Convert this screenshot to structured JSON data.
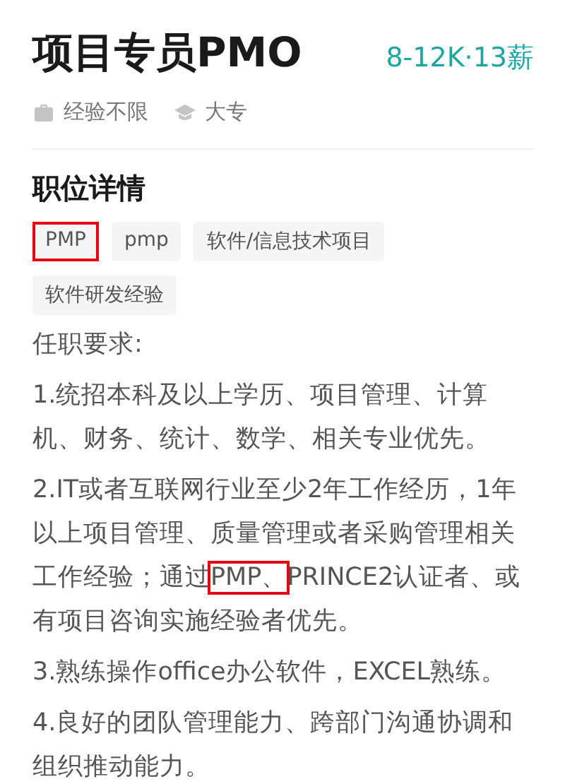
{
  "job": {
    "title": "项目专员PMO",
    "salary": "8-12K·13薪",
    "meta": [
      {
        "kind": "experience",
        "text": "经验不限"
      },
      {
        "kind": "education",
        "text": "大专"
      }
    ]
  },
  "details": {
    "heading": "职位详情",
    "tags": [
      {
        "label": "PMP",
        "highlighted": true
      },
      {
        "label": "pmp",
        "highlighted": false
      },
      {
        "label": "软件/信息技术项目",
        "highlighted": false
      },
      {
        "label": "软件研发经验",
        "highlighted": false
      }
    ],
    "paragraphs": [
      {
        "parts": [
          {
            "text": "任职要求:",
            "highlighted": false
          }
        ]
      },
      {
        "parts": [
          {
            "text": "1.统招本科及以上学历、项目管理、计算机、财务、统计、数学、相关专业优先。",
            "highlighted": false
          }
        ]
      },
      {
        "parts": [
          {
            "text": "2.IT或者互联网行业至少2年工作经历，1年以上项目管理、质量管理或者采购管理相关工作经验；通过",
            "highlighted": false
          },
          {
            "text": "PMP、",
            "highlighted": true
          },
          {
            "text": "PRINCE2认证者、或有项目咨询实施经验者优先。",
            "highlighted": false
          }
        ]
      },
      {
        "parts": [
          {
            "text": "3.熟练操作office办公软件，EXCEL熟练。",
            "highlighted": false
          }
        ]
      },
      {
        "parts": [
          {
            "text": "4.良好的团队管理能力、跨部门沟通协调和组织推动能力。",
            "highlighted": false
          }
        ]
      }
    ]
  }
}
